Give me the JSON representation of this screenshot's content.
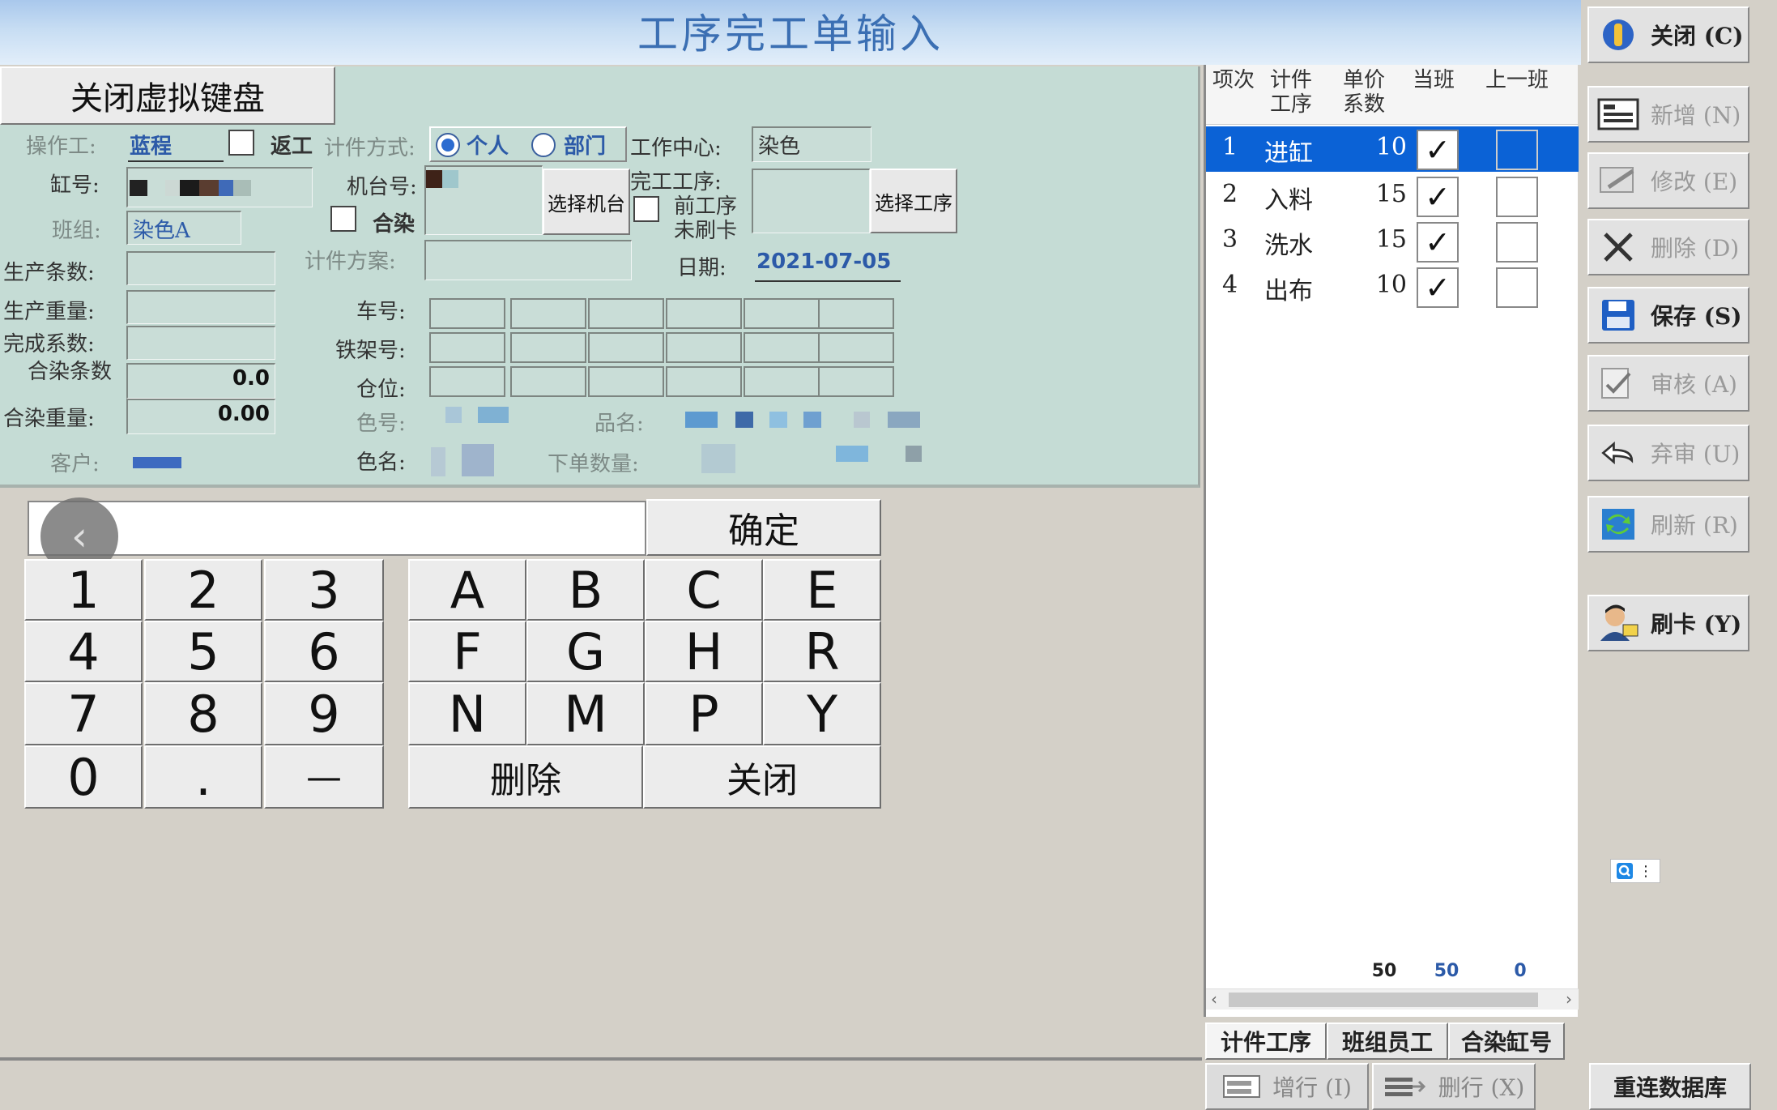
{
  "window": {
    "title": "工序完工单输入"
  },
  "form": {
    "vk_toggle": "关闭虚拟键盘",
    "operator_label": "操作工:",
    "operator_value": "蓝程",
    "rework_label": "返工",
    "piece_method_label": "计件方式:",
    "method_personal": "个人",
    "method_dept": "部门",
    "work_center_label": "工作中心:",
    "work_center_value": "染色",
    "vat_label": "缸号:",
    "machine_label": "机台号:",
    "select_machine": "选择机台",
    "finish_proc_label": "完工工序:",
    "prev_unswiped_label_1": "前工序",
    "prev_unswiped_label_2": "未刷卡",
    "select_process": "选择工序",
    "team_label": "班组:",
    "team_value": "染色A",
    "combined_label": "合染",
    "piece_plan_label": "计件方案:",
    "date_label": "日期:",
    "date_value": "2021-07-05",
    "prod_count_label": "生产条数:",
    "prod_weight_label": "生产重量:",
    "complete_coef_label": "完成系数:",
    "combined_count_label": "合染条数",
    "combined_count_value": "0.0",
    "combined_weight_label": "合染重量:",
    "combined_weight_value": "0.00",
    "customer_label": "客户:",
    "car_label": "车号:",
    "rack_label": "铁架号:",
    "bin_label": "仓位:",
    "color_no_label": "色号:",
    "product_label": "品名:",
    "color_name_label": "色名:",
    "order_qty_label": "下单数量:"
  },
  "keyboard": {
    "back_glyph": "‹",
    "confirm": "确定",
    "digits": [
      "1",
      "2",
      "3",
      "4",
      "5",
      "6",
      "7",
      "8",
      "9",
      "0",
      ".",
      "—"
    ],
    "letters": [
      "A",
      "B",
      "C",
      "E",
      "F",
      "G",
      "H",
      "R",
      "N",
      "M",
      "P",
      "Y"
    ],
    "delete": "删除",
    "close": "关闭"
  },
  "list": {
    "headers": {
      "seq": "项次",
      "proc_1": "计件",
      "proc_2": "工序",
      "price_1": "单价",
      "price_2": "系数",
      "shift": "当班",
      "prev_shift": "上一班"
    },
    "rows": [
      {
        "seq": "1",
        "proc": "进缸",
        "price": "10",
        "shift": "✓",
        "prev": ""
      },
      {
        "seq": "2",
        "proc": "入料",
        "price": "15",
        "shift": "✓",
        "prev": ""
      },
      {
        "seq": "3",
        "proc": "洗水",
        "price": "15",
        "shift": "✓",
        "prev": ""
      },
      {
        "seq": "4",
        "proc": "出布",
        "price": "10",
        "shift": "✓",
        "prev": ""
      }
    ],
    "totals": {
      "price": "50",
      "shift": "50",
      "prev": "0"
    },
    "tabs": [
      "计件工序",
      "班组员工",
      "合染缸号"
    ],
    "add_row": "增行 (I)",
    "del_row": "删行 (X)"
  },
  "toolbar": {
    "close": "关闭 (C)",
    "add": "新增 (N)",
    "edit": "修改 (E)",
    "delete": "删除 (D)",
    "save": "保存 (S)",
    "audit": "审核 (A)",
    "unaudit": "弃审 (U)",
    "refresh": "刷新 (R)",
    "swipe": "刷卡 (Y)",
    "reconnect": "重连数据库"
  },
  "colors": {
    "title": "#3b6fb3",
    "selection": "#0b62d6",
    "form_bg": "#c5dcd5",
    "value_text": "#2c5aa8"
  }
}
